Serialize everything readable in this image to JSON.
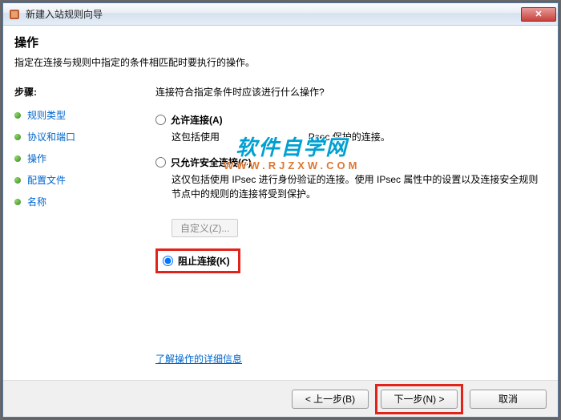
{
  "window": {
    "title": "新建入站规则向导",
    "close_glyph": "✕"
  },
  "header": {
    "title": "操作",
    "subtitle": "指定在连接与规则中指定的条件相匹配时要执行的操作。"
  },
  "sidebar": {
    "title": "步骤:",
    "items": [
      {
        "label": "规则类型"
      },
      {
        "label": "协议和端口"
      },
      {
        "label": "操作"
      },
      {
        "label": "配置文件"
      },
      {
        "label": "名称"
      }
    ]
  },
  "panel": {
    "question": "连接符合指定条件时应该进行什么操作?",
    "options": {
      "allow": {
        "label": "允许连接(A)",
        "desc_prefix": "这包括使用",
        "desc_suffix": "Psec 保护的连接。"
      },
      "secure": {
        "label": "只允许安全连接(C)",
        "desc": "这仅包括使用 IPsec 进行身份验证的连接。使用 IPsec 属性中的设置以及连接安全规则节点中的规则的连接将受到保护。"
      },
      "block": {
        "label": "阻止连接(K)"
      }
    },
    "customize_label": "自定义(Z)...",
    "more_info": "了解操作的详细信息"
  },
  "footer": {
    "back": "< 上一步(B)",
    "next": "下一步(N) >",
    "cancel": "取消"
  },
  "watermark": {
    "line1": "软件自学网",
    "line2": "WWW.RJZXW.COM"
  }
}
